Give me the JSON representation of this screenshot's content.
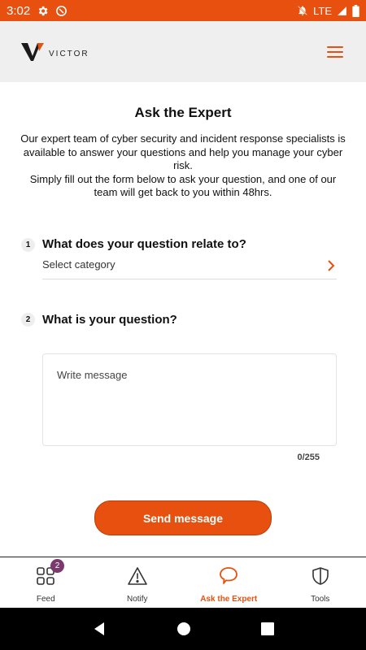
{
  "status_bar": {
    "time": "3:02",
    "network": "LTE",
    "color": "#e8500f"
  },
  "header": {
    "logo_text": "VICTOR"
  },
  "page": {
    "title": "Ask the Expert",
    "intro_line1": "Our expert team of cyber security and incident response specialists is available to answer your questions and help you manage your cyber risk.",
    "intro_line2": "Simply fill out the form below to ask your question, and one of our team will get back to you within 48hrs."
  },
  "form": {
    "q1_number": "1",
    "q1_text": "What does your question relate to?",
    "q1_select_placeholder": "Select category",
    "q2_number": "2",
    "q2_text": "What is your question?",
    "q2_placeholder": "Write message",
    "counter": "0/255",
    "send_label": "Send message"
  },
  "bottom_nav": {
    "items": [
      {
        "label": "Feed",
        "icon": "grid-icon",
        "badge": "2"
      },
      {
        "label": "Notify",
        "icon": "warning-icon"
      },
      {
        "label": "Ask the Expert",
        "icon": "chat-bubble-icon",
        "active": true
      },
      {
        "label": "Tools",
        "icon": "shield-icon"
      }
    ]
  },
  "colors": {
    "accent": "#e8500f",
    "badge": "#7b3a6e"
  }
}
